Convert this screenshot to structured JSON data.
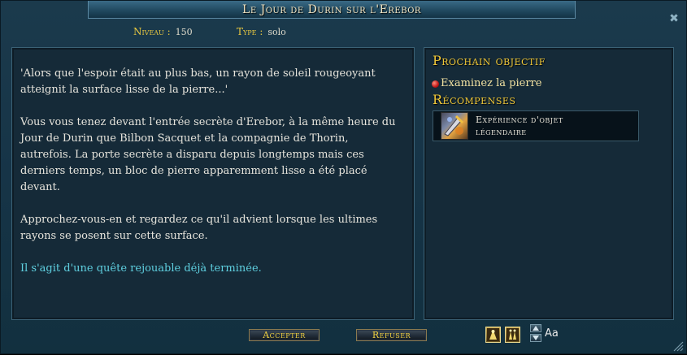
{
  "window": {
    "title": "Le Jour de Durin sur l'Erebor",
    "close_icon": "close-icon"
  },
  "meta": {
    "level_label": "Niveau :",
    "level_value": "150",
    "type_label": "Type :",
    "type_value": "solo"
  },
  "description": {
    "paragraphs": [
      "'Alors que l'espoir était au plus bas, un rayon de soleil rougeoyant atteignit la surface lisse de la pierre...'",
      "Vous vous tenez devant l'entrée secrète d'Erebor, à la même heure du Jour de Durin que Bilbon Sacquet et la compagnie de Thorin, autrefois. La porte secrète a disparu depuis longtemps mais ces derniers temps, un bloc de pierre apparemment lisse a été placé devant.",
      "Approchez-vous-en et regardez ce qu'il advient lorsque les ultimes rayons se posent sur cette surface."
    ],
    "replay_note": "Il s'agit d'une quête rejouable déjà terminée."
  },
  "objectives": {
    "header": "Prochain objectif",
    "items": [
      "Examinez la pierre"
    ]
  },
  "rewards": {
    "header": "Récompenses",
    "items": [
      {
        "label_line1": "Expérience d'objet",
        "label_line2": "légendaire",
        "icon": "legendary-item-xp-icon"
      }
    ]
  },
  "buttons": {
    "accept": "Accepter",
    "refuse": "Refuser"
  },
  "toolbar": {
    "font_label": "Aa",
    "icons": [
      "track-quest-icon",
      "share-quest-icon",
      "font-size-up-icon",
      "font-size-down-icon",
      "resize-grip-icon"
    ]
  },
  "colors": {
    "title_text": "#f2e6c4",
    "header_gold": "#f0c838",
    "replay_cyan": "#5fd0e0",
    "body_text": "#e6e4dc"
  }
}
